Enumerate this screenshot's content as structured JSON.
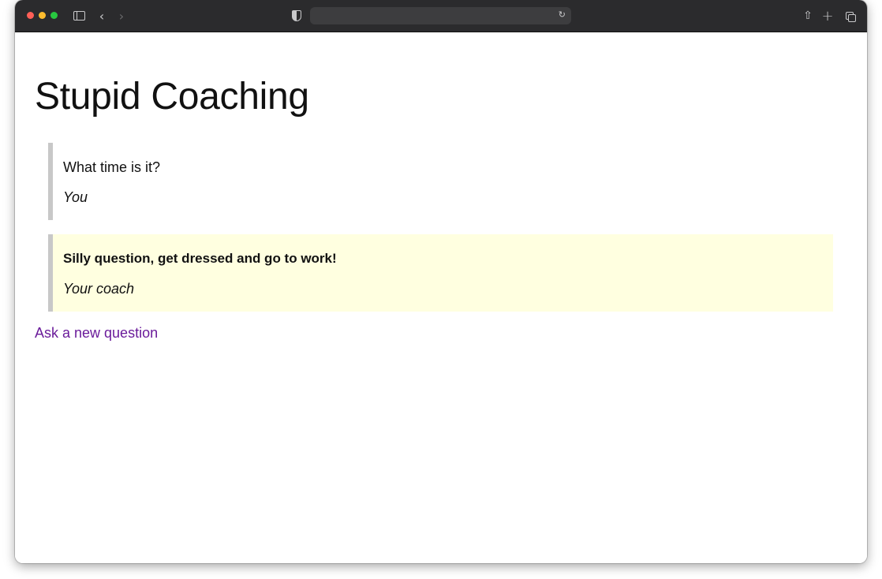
{
  "browser": {
    "address": "",
    "icons": {
      "sidebar": "sidebar-toggle-icon",
      "back": "chevron-left-icon",
      "forward": "chevron-right-icon",
      "privacy": "shield-icon",
      "reload": "reload-icon",
      "share": "share-icon",
      "new_tab": "plus-icon",
      "tabs": "tab-overview-icon"
    },
    "traffic_colors": {
      "close": "#ff5f57",
      "minimize": "#febc2e",
      "zoom": "#28c840"
    }
  },
  "page": {
    "title": "Stupid Coaching",
    "question": {
      "text": "What time is it?",
      "author": "You"
    },
    "answer": {
      "text": "Silly question, get dressed and go to work!",
      "author": "Your coach",
      "background": "#ffffe0"
    },
    "ask_link": "Ask a new question",
    "link_color": "#6a1b9a"
  }
}
